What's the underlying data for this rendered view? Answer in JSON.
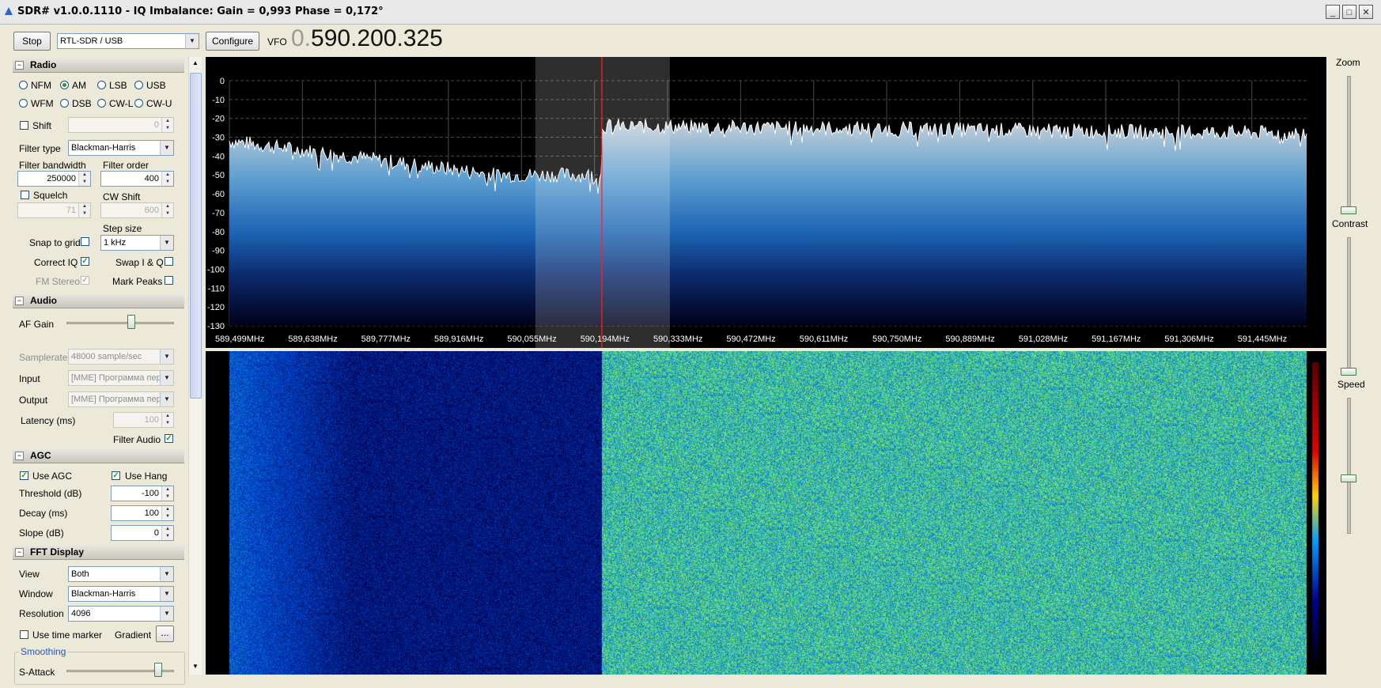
{
  "window": {
    "title": "SDR# v1.0.0.1110 - IQ Imbalance: Gain = 0,993 Phase = 0,172°",
    "buttons": [
      "minimize",
      "maximize",
      "close"
    ]
  },
  "toolbar": {
    "stop_label": "Stop",
    "device": "RTL-SDR / USB",
    "configure_label": "Configure",
    "vfo_label": "VFO",
    "vfo_prefix": "0.",
    "vfo_value": "590.200.325"
  },
  "radio": {
    "title": "Radio",
    "modes": [
      "NFM",
      "AM",
      "LSB",
      "USB",
      "WFM",
      "DSB",
      "CW-L",
      "CW-U"
    ],
    "selected_mode": "AM",
    "shift_label": "Shift",
    "shift_value": "0",
    "filter_type_label": "Filter type",
    "filter_type": "Blackman-Harris",
    "filter_bandwidth_label": "Filter bandwidth",
    "filter_bandwidth": "250000",
    "filter_order_label": "Filter order",
    "filter_order": "400",
    "squelch_label": "Squelch",
    "squelch_value": "71",
    "cw_shift_label": "CW Shift",
    "cw_shift_value": "600",
    "step_size_label": "Step size",
    "step_size": "1 kHz",
    "snap_label": "Snap to grid",
    "correct_iq_label": "Correct IQ",
    "swap_iq_label": "Swap I & Q",
    "fm_stereo_label": "FM Stereo",
    "mark_peaks_label": "Mark Peaks"
  },
  "audio": {
    "title": "Audio",
    "af_gain_label": "AF Gain",
    "af_gain_level": 0.6,
    "samplerate_label": "Samplerate",
    "samplerate": "48000 sample/sec",
    "input_label": "Input",
    "input": "[MME] Программа пер",
    "output_label": "Output",
    "output": "[MME] Программа пер",
    "latency_label": "Latency (ms)",
    "latency": "100",
    "filter_audio_label": "Filter Audio"
  },
  "agc": {
    "title": "AGC",
    "use_agc_label": "Use AGC",
    "use_hang_label": "Use Hang",
    "threshold_label": "Threshold (dB)",
    "threshold": "-100",
    "decay_label": "Decay (ms)",
    "decay": "100",
    "slope_label": "Slope (dB)",
    "slope": "0"
  },
  "fft": {
    "title": "FFT Display",
    "view_label": "View",
    "view": "Both",
    "window_label": "Window",
    "window": "Blackman-Harris",
    "resolution_label": "Resolution",
    "resolution": "4096",
    "time_marker_label": "Use time marker",
    "gradient_label": "Gradient",
    "gradient_btn": "...",
    "smoothing_label": "Smoothing",
    "s_attack_label": "S-Attack"
  },
  "right_panel": {
    "zoom_label": "Zoom",
    "contrast_label": "Contrast",
    "speed_label": "Speed",
    "zoom_level": 0.0,
    "contrast_level": 0.0,
    "speed_level": 0.4
  },
  "spectrum": {
    "y_ticks": [
      "0",
      "-10",
      "-20",
      "-30",
      "-40",
      "-50",
      "-60",
      "-70",
      "-80",
      "-90",
      "-100",
      "-110",
      "-120",
      "-130"
    ],
    "x_ticks": [
      "589,499MHz",
      "589,638MHz",
      "589,777MHz",
      "589,916MHz",
      "590,055MHz",
      "590,194MHz",
      "590,333MHz",
      "590,472MHz",
      "590,611MHz",
      "590,750MHz",
      "590,889MHz",
      "591,028MHz",
      "591,167MHz",
      "591,306MHz",
      "591,445MHz"
    ],
    "colors": {
      "background": "#000000",
      "trace": "#ffffff",
      "grid": "#4a4a4a",
      "marker": "#ff2020",
      "fill_top": "#9ab4c8",
      "fill_bottom": "#000018"
    }
  }
}
